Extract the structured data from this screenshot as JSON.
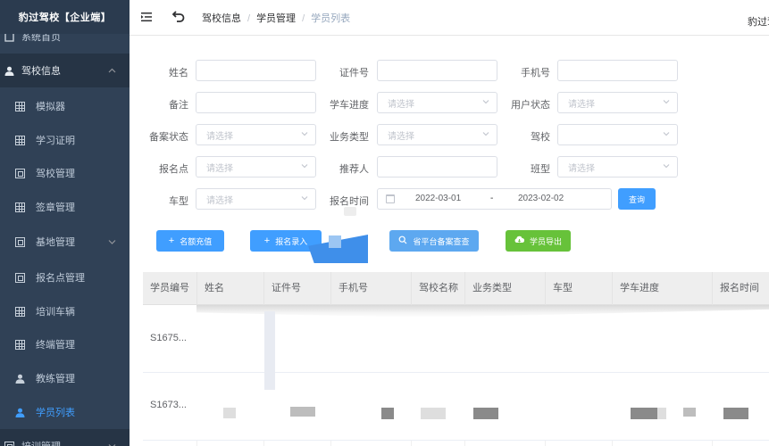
{
  "sidebar": {
    "brand": "豹过驾校【企业端】",
    "partial_top": "系统首页",
    "items": [
      {
        "label": "驾校信息",
        "icon": "user-icon",
        "expanded": true
      },
      {
        "label": "模拟器",
        "icon": "grid-icon"
      },
      {
        "label": "学习证明",
        "icon": "grid-icon"
      },
      {
        "label": "驾校管理",
        "icon": "box-icon"
      },
      {
        "label": "签章管理",
        "icon": "grid-icon"
      },
      {
        "label": "基地管理",
        "icon": "box-icon",
        "has_arrow": true
      },
      {
        "label": "报名点管理",
        "icon": "box-icon"
      },
      {
        "label": "培训车辆",
        "icon": "grid-icon"
      },
      {
        "label": "终端管理",
        "icon": "grid-icon"
      },
      {
        "label": "教练管理",
        "icon": "user-icon"
      },
      {
        "label": "学员列表",
        "icon": "user-icon",
        "active": true
      },
      {
        "label": "培训管理",
        "icon": "box-icon",
        "has_arrow": true
      }
    ]
  },
  "header": {
    "breadcrumb": [
      "驾校信息",
      "学员管理",
      "学员列表"
    ],
    "user": "豹过驾"
  },
  "form": {
    "name_label": "姓名",
    "id_label": "证件号",
    "phone_label": "手机号",
    "remark_label": "备注",
    "progress_label": "学车进度",
    "user_status_label": "用户状态",
    "filing_status_label": "备案状态",
    "business_type_label": "业务类型",
    "school_label": "驾校",
    "signup_point_label": "报名点",
    "referrer_label": "推荐人",
    "class_label": "班型",
    "car_type_label": "车型",
    "signup_time_label": "报名时间",
    "select_placeholder": "请选择",
    "date_start": "2022-03-01",
    "date_sep": "-",
    "date_end": "2023-02-02",
    "query_button": "查询"
  },
  "actions": {
    "recharge": "名额充值",
    "enroll": "报名录入",
    "query_platform": "省平台备案查查",
    "export": "学员导出"
  },
  "table": {
    "columns": [
      "学员编号",
      "姓名",
      "证件号",
      "手机号",
      "驾校名称",
      "业务类型",
      "车型",
      "学车进度",
      "报名时间"
    ],
    "rows": [
      {
        "id": "S1675..."
      },
      {
        "id": "S1673..."
      }
    ]
  },
  "colors": {
    "sidebar_bg": "#304156",
    "brand_bg": "#2b3b4f",
    "primary": "#409eff",
    "success": "#67c23a",
    "menu_text": "#bfcbd9"
  }
}
